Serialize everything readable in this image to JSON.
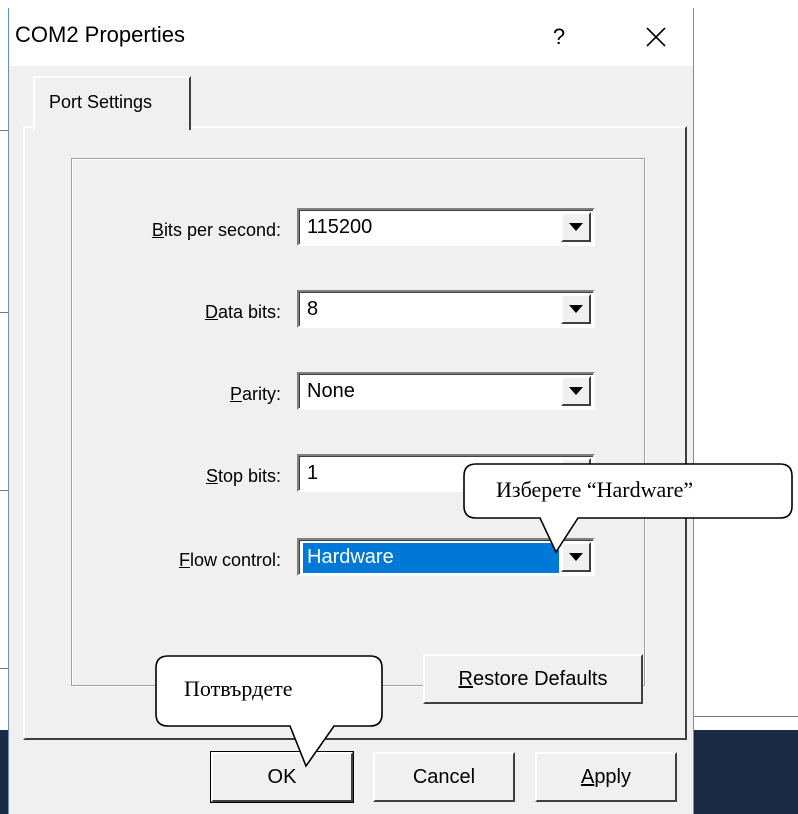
{
  "dialog": {
    "title": "COM2 Properties",
    "help_label": "?",
    "close_icon": "close-icon"
  },
  "tabs": [
    {
      "label": "Port Settings",
      "selected": true
    }
  ],
  "settings": [
    {
      "label_mnemonic": "B",
      "label_rest": "its per second:",
      "value": "115200"
    },
    {
      "label_mnemonic": "D",
      "label_rest": "ata bits:",
      "value": "8"
    },
    {
      "label_mnemonic": "P",
      "label_rest": "arity:",
      "value": "None"
    },
    {
      "label_mnemonic": "S",
      "label_rest": "top bits:",
      "value": "1"
    },
    {
      "label_mnemonic": "F",
      "label_rest": "low control:",
      "value": "Hardware",
      "highlighted": true
    }
  ],
  "buttons": {
    "restore_mnemonic": "R",
    "restore_rest": "estore Defaults",
    "ok": "OK",
    "cancel": "Cancel",
    "apply_mnemonic": "A",
    "apply_rest": "pply"
  },
  "callouts": {
    "flow_hint": "Изберете “Hardware”",
    "ok_hint": "Потвърдете"
  },
  "colors": {
    "selection": "#0078d7",
    "dialog_bg": "#f0f0f0",
    "taskbar": "#1b2a44"
  }
}
